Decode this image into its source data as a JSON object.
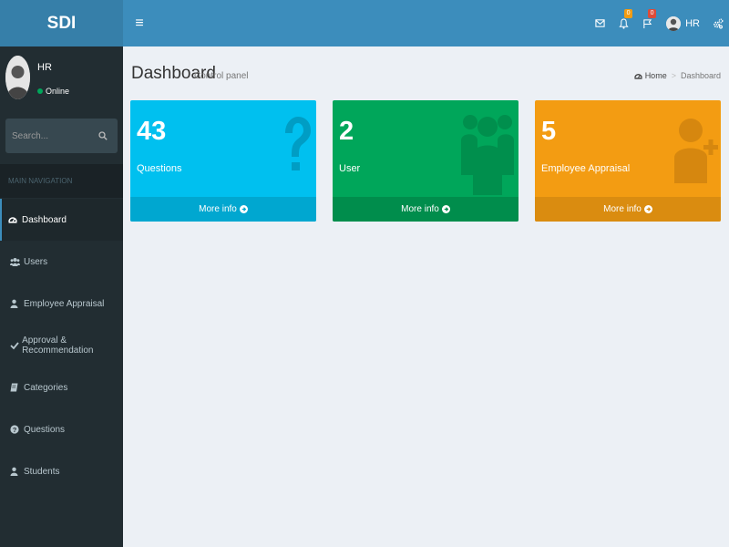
{
  "header": {
    "logo": "SDI",
    "toggle_glyph": "≡",
    "notifications_count": "0",
    "flags_count": "0",
    "user_name": "HR"
  },
  "sidebar": {
    "user_name": "HR",
    "status": "Online",
    "search_placeholder": "Search...",
    "nav_header": "MAIN NAVIGATION",
    "items": [
      {
        "label": "Dashboard",
        "icon": "dashboard-icon"
      },
      {
        "label": "Users",
        "icon": "users-icon"
      },
      {
        "label": "Employee Appraisal",
        "icon": "user-icon"
      },
      {
        "label": "Approval & Recommendation",
        "icon": "check-icon"
      },
      {
        "label": "Categories",
        "icon": "book-icon"
      },
      {
        "label": "Questions",
        "icon": "question-circle-icon"
      },
      {
        "label": "Students",
        "icon": "user-icon"
      }
    ]
  },
  "content": {
    "title": "Dashboard",
    "subtitle": "Control panel",
    "breadcrumb": {
      "home": "Home",
      "current": "Dashboard"
    }
  },
  "boxes": [
    {
      "value": "43",
      "label": "Questions",
      "footer": "More info",
      "color": "#00c0ef",
      "icon": "question-icon"
    },
    {
      "value": "2",
      "label": "User",
      "footer": "More info",
      "color": "#00a65a",
      "icon": "users-icon"
    },
    {
      "value": "5",
      "label": "Employee Appraisal",
      "footer": "More info",
      "color": "#f39c12",
      "icon": "user-plus-icon"
    }
  ],
  "colors": {
    "header": "#3c8dbc",
    "logo_bg": "#367fa9",
    "sidebar": "#222d32",
    "content_bg": "#ecf0f5"
  }
}
